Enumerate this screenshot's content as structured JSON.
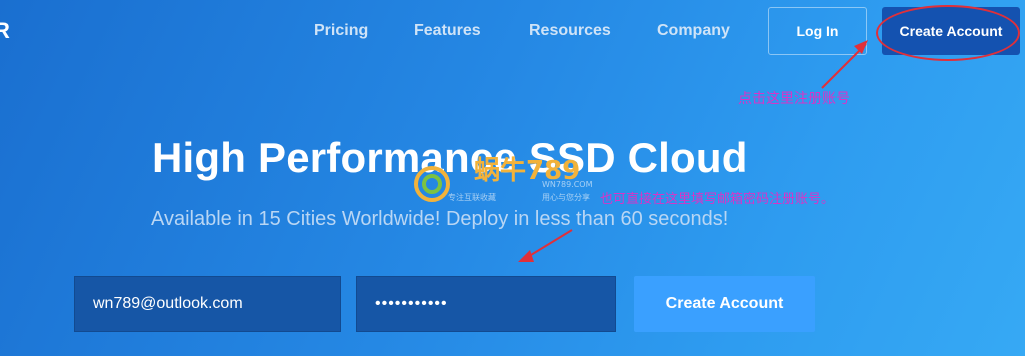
{
  "header": {
    "logo_fragment": "R",
    "nav": [
      {
        "label": "Pricing"
      },
      {
        "label": "Features"
      },
      {
        "label": "Resources"
      },
      {
        "label": "Company"
      }
    ],
    "login_label": "Log In",
    "create_account_label": "Create Account"
  },
  "hero": {
    "title": "High Performance SSD Cloud",
    "subtitle": "Available in 15 Cities Worldwide! Deploy in less than 60 seconds!"
  },
  "signup": {
    "email_value": "wn789@outlook.com",
    "password_value": "•••••••••••",
    "submit_label": "Create Account"
  },
  "annotations": {
    "top_note": "点击这里注册账号",
    "form_note": "也可直接在这里填写邮箱密码注册账号。",
    "color": "#d834c8",
    "highlight_color": "#e0303a"
  },
  "watermark": {
    "brand": "蜗牛789",
    "domain": "WN789.COM",
    "tagline_1": "专注互联收藏",
    "tagline_2": "用心与您分享"
  }
}
